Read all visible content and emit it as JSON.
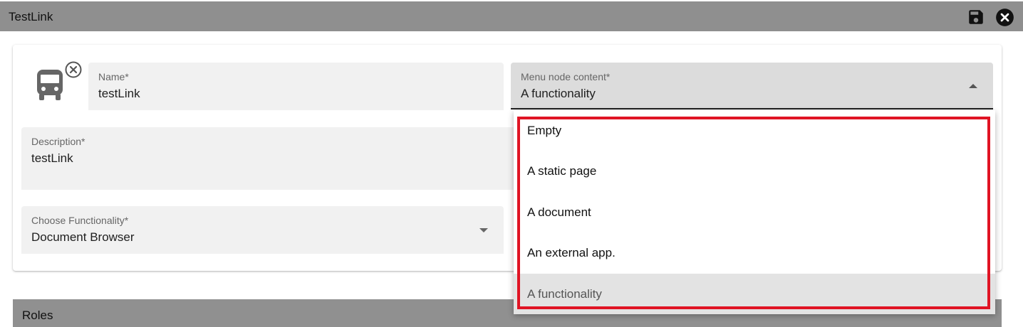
{
  "header": {
    "title": "TestLink",
    "save_icon": "save-icon",
    "close_icon": "close-icon"
  },
  "form": {
    "icon": "bus-icon",
    "remove_icon": "remove-icon",
    "name": {
      "label": "Name*",
      "value": "testLink"
    },
    "description": {
      "label": "Description*",
      "value": "testLink"
    },
    "functionality": {
      "label": "Choose Functionality*",
      "value": "Document Browser"
    },
    "menu_node_content": {
      "label": "Menu node content*",
      "value": "A functionality",
      "options": [
        "Empty",
        "A static page",
        "A document",
        "An external app.",
        "A functionality"
      ]
    }
  },
  "annotation": {
    "highlight_color": "#e01424"
  },
  "roles": {
    "label": "Roles"
  }
}
